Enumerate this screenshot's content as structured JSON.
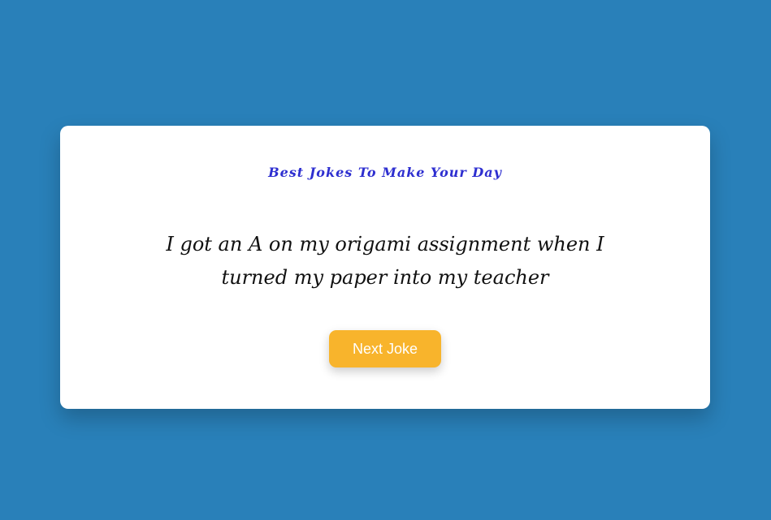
{
  "card": {
    "title": "Best Jokes To Make Your Day",
    "joke_text": "I got an A on my origami assignment when I turned my paper into my teacher",
    "next_button_label": "Next Joke"
  },
  "colors": {
    "page_background": "#2980b9",
    "card_background": "#ffffff",
    "title": "#2e2fd0",
    "joke_text": "#111111",
    "button_background": "#f8b42c",
    "button_text": "#ffffff"
  }
}
